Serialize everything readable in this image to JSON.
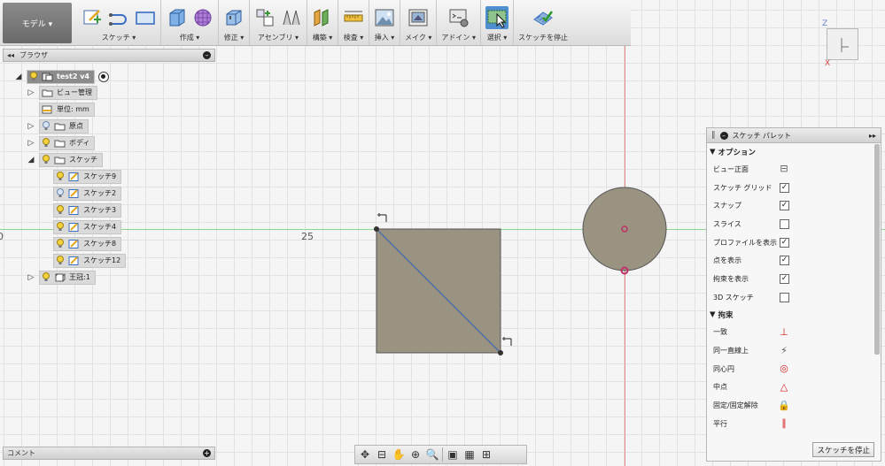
{
  "toolbar": {
    "workspace": "モデル ▾",
    "groups": [
      {
        "label": "スケッチ ▾"
      },
      {
        "label": "作成 ▾"
      },
      {
        "label": "修正 ▾"
      },
      {
        "label": "アセンブリ ▾"
      },
      {
        "label": "構築 ▾"
      },
      {
        "label": "検査 ▾"
      },
      {
        "label": "挿入 ▾"
      },
      {
        "label": "メイク ▾"
      },
      {
        "label": "アドイン ▾"
      },
      {
        "label": "選択 ▾"
      },
      {
        "label": "スケッチを停止"
      }
    ]
  },
  "viewcube": {
    "z": "Z",
    "x": "X"
  },
  "canvas": {
    "tick_0": "0",
    "tick_25": "25"
  },
  "browser": {
    "title": "ブラウザ",
    "root": "test2 v4",
    "items": [
      {
        "label": "ビュー管理"
      },
      {
        "label": "単位: mm"
      },
      {
        "label": "原点"
      },
      {
        "label": "ボディ"
      },
      {
        "label": "スケッチ"
      },
      {
        "label": "スケッチ9"
      },
      {
        "label": "スケッチ2"
      },
      {
        "label": "スケッチ3"
      },
      {
        "label": "スケッチ4"
      },
      {
        "label": "スケッチ8"
      },
      {
        "label": "スケッチ12"
      },
      {
        "label": "王冠:1"
      }
    ]
  },
  "comments": {
    "title": "コメント"
  },
  "palette": {
    "title": "スケッチ パレット",
    "options_header": "オプション",
    "options": [
      {
        "label": "ビュー正面",
        "type": "button"
      },
      {
        "label": "スケッチ グリッド",
        "checked": true
      },
      {
        "label": "スナップ",
        "checked": true
      },
      {
        "label": "スライス",
        "checked": false
      },
      {
        "label": "プロファイルを表示",
        "checked": true
      },
      {
        "label": "点を表示",
        "checked": true
      },
      {
        "label": "拘束を表示",
        "checked": true
      },
      {
        "label": "3D スケッチ",
        "checked": false
      }
    ],
    "constraints_header": "拘束",
    "constraints": [
      {
        "label": "一致"
      },
      {
        "label": "同一直線上"
      },
      {
        "label": "同心円"
      },
      {
        "label": "中点"
      },
      {
        "label": "固定/固定解除"
      },
      {
        "label": "平行"
      }
    ],
    "stop_button": "スケッチを停止"
  },
  "colors": {
    "accent": "#4f8fd0",
    "profile": "#9a9382",
    "constraint": "#d01a1a"
  }
}
